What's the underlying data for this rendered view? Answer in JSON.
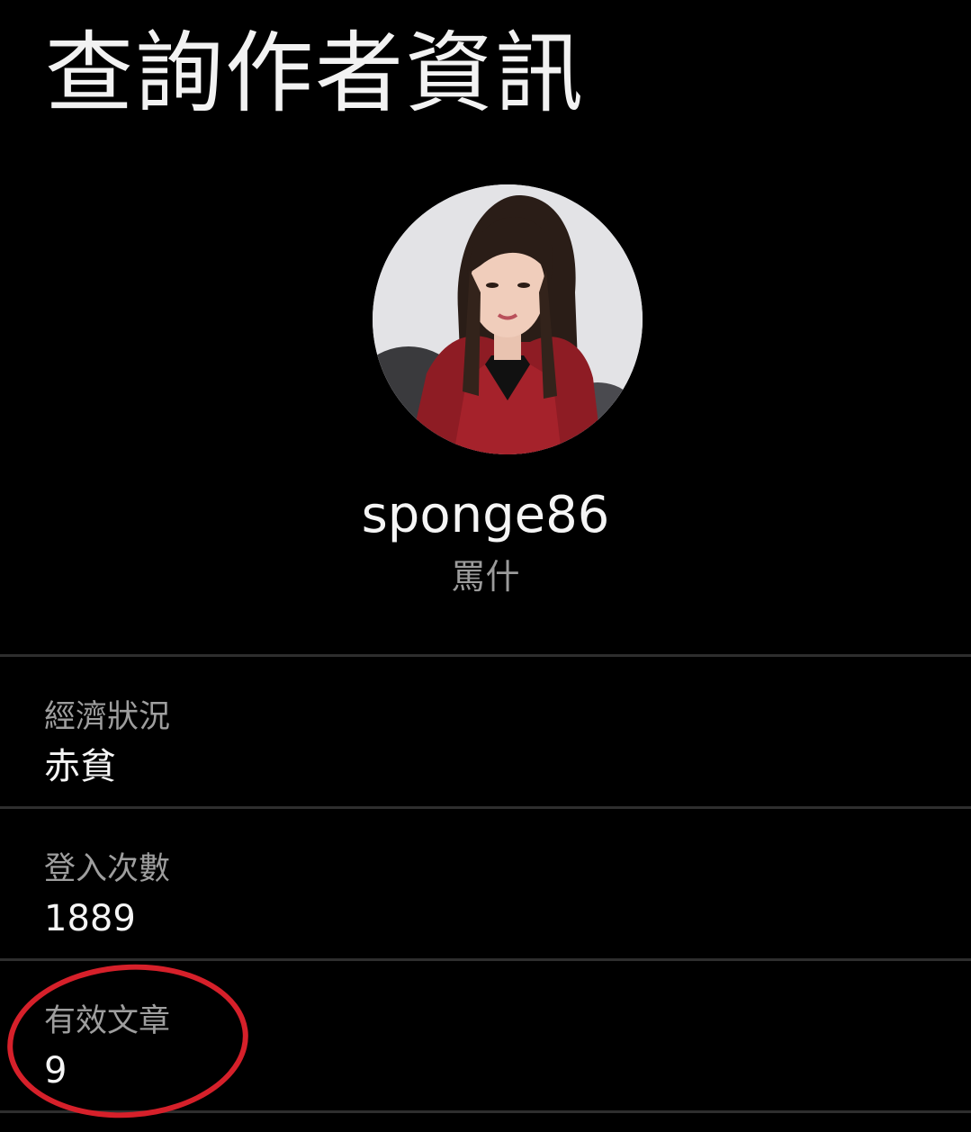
{
  "header": {
    "title": "查詢作者資訊"
  },
  "profile": {
    "username": "sponge86",
    "nickname": "罵什"
  },
  "info": {
    "items": [
      {
        "label": "經濟狀況",
        "value": "赤貧"
      },
      {
        "label": "登入次數",
        "value": "1889"
      },
      {
        "label": "有效文章",
        "value": "9"
      }
    ]
  },
  "colors": {
    "background": "#000000",
    "title_text": "#f2f2f2",
    "secondary_text": "#9e9e9e",
    "divider": "#2e2e2e",
    "annotation": "#d6202a"
  }
}
